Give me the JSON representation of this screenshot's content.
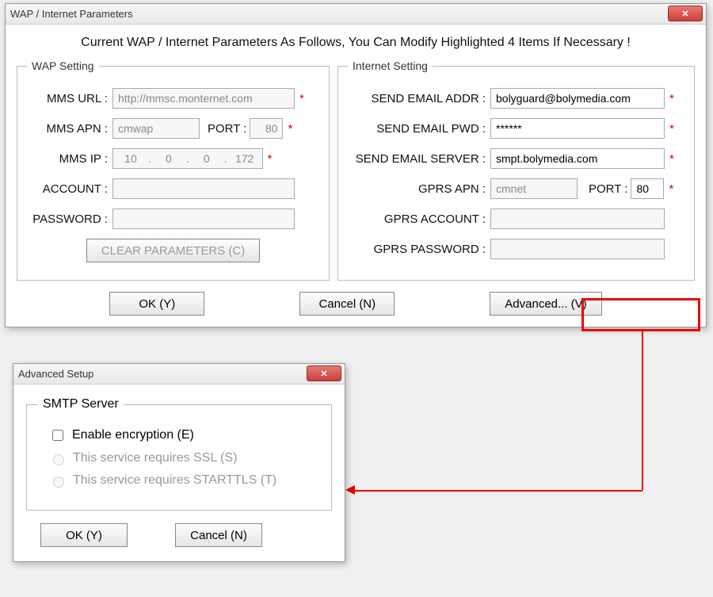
{
  "main": {
    "title": "WAP / Internet Parameters",
    "instruction": "Current WAP / Internet Parameters As Follows, You Can Modify Highlighted 4 Items If Necessary !",
    "wap": {
      "legend": "WAP Setting",
      "mms_url_label": "MMS URL :",
      "mms_url": "http://mmsc.monternet.com",
      "mms_apn_label": "MMS APN :",
      "mms_apn": "cmwap",
      "port_label": "PORT :",
      "mms_port": "80",
      "mms_ip_label": "MMS IP :",
      "ip": [
        "10",
        "0",
        "0",
        "172"
      ],
      "account_label": "ACCOUNT :",
      "account": "",
      "password_label": "PASSWORD :",
      "password": "",
      "clear_btn": "CLEAR PARAMETERS (C)"
    },
    "inet": {
      "legend": "Internet Setting",
      "send_addr_label": "SEND EMAIL ADDR :",
      "send_addr": "bolyguard@bolymedia.com",
      "send_pwd_label": "SEND EMAIL PWD :",
      "send_pwd": "******",
      "send_srv_label": "SEND EMAIL SERVER :",
      "send_srv": "smpt.bolymedia.com",
      "gprs_apn_label": "GPRS APN :",
      "gprs_apn": "cmnet",
      "gprs_port_label": "PORT :",
      "gprs_port": "80",
      "gprs_acct_label": "GPRS ACCOUNT :",
      "gprs_acct": "",
      "gprs_pwd_label": "GPRS PASSWORD :",
      "gprs_pwd": ""
    },
    "ok_btn": "OK (Y)",
    "cancel_btn": "Cancel (N)",
    "advanced_btn": "Advanced... (V)"
  },
  "adv": {
    "title": "Advanced Setup",
    "legend": "SMTP Server",
    "enable_enc": "Enable encryption (E)",
    "ssl": "This service requires SSL (S)",
    "starttls": "This service requires  STARTTLS (T)",
    "ok_btn": "OK (Y)",
    "cancel_btn": "Cancel (N)"
  }
}
